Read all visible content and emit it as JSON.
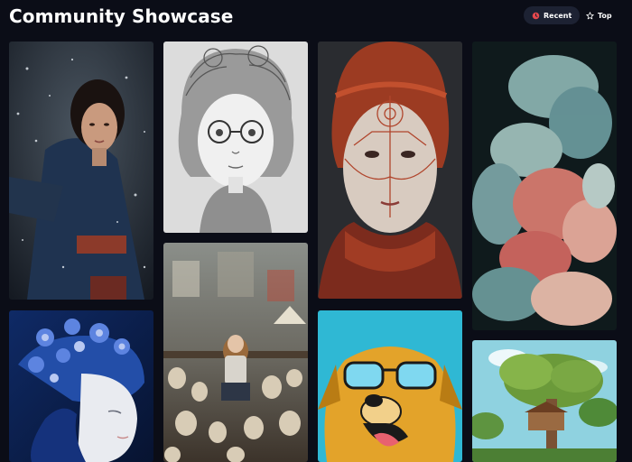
{
  "header": {
    "title": "Community Showcase",
    "sort_options": [
      {
        "label": "Recent",
        "icon": "clock-icon",
        "active": true
      },
      {
        "label": "Top",
        "icon": "star-icon",
        "active": false
      }
    ]
  },
  "colors": {
    "background": "#0b0d17",
    "active_pill": "#1d2233",
    "recent_icon": "#e5484d"
  },
  "gallery": [
    {
      "icon": "warrior-woman-snow-image"
    },
    {
      "icon": "sketch-girl-glasses-image"
    },
    {
      "icon": "woman-red-face-paint-image"
    },
    {
      "icon": "colorful-smoke-image"
    },
    {
      "icon": "paper-flower-head-image"
    },
    {
      "icon": "miniature-workshop-image"
    },
    {
      "icon": "dog-sunglasses-illustration-image"
    },
    {
      "icon": "treehouse-illustration-image"
    }
  ]
}
